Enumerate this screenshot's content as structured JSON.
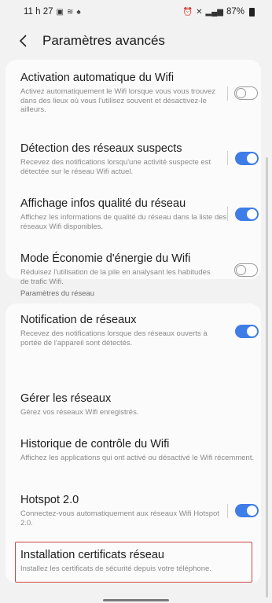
{
  "status": {
    "time": "11 h 27",
    "battery": "87%"
  },
  "header": {
    "title": "Paramètres avancés"
  },
  "items": [
    {
      "title": "Activation automatique du Wifi",
      "desc": "Activez automatiquement le Wifi lorsque vous vous trouvez dans des lieux où vous l'utilisez souvent et désactivez-le ailleurs.",
      "toggle": "off"
    },
    {
      "title": "Détection des réseaux suspects",
      "desc": "Recevez des notifications lorsqu'une activité suspecte est détectée sur le réseau Wifi actuel.",
      "toggle": "on"
    },
    {
      "title": "Affichage infos qualité du réseau",
      "desc": "Affichez les informations de qualité du réseau dans la liste des réseaux Wifi disponibles.",
      "toggle": "on"
    },
    {
      "title": "Mode Économie d'énergie du Wifi",
      "desc": "Réduisez l'utilisation de la pile en analysant les habitudes de trafic Wifi.",
      "toggle": "off"
    }
  ],
  "network_section": {
    "header": "Paramètres du réseau",
    "items": [
      {
        "title": "Notification de réseaux",
        "desc": "Recevez des notifications lorsque des réseaux ouverts à portée de l'appareil sont détectés.",
        "toggle": "on"
      },
      {
        "title": "Gérer les réseaux",
        "desc": "Gérez vos réseaux Wifi enregistrés."
      },
      {
        "title": "Historique de contrôle du Wifi",
        "desc": "Affichez les applications qui ont activé ou désactivé le Wifi récemment."
      },
      {
        "title": "Hotspot 2.0",
        "desc": "Connectez-vous automatiquement aux réseaux Wifi Hotspot 2.0.",
        "toggle": "on"
      },
      {
        "title": "Installation certificats réseau",
        "desc": "Installez les certificats de sécurité depuis votre téléphone."
      }
    ]
  },
  "colors": {
    "accent": "#3e7ce8",
    "highlight": "#c94444",
    "background": "#f2f2f2",
    "card": "#fbfbfb"
  }
}
